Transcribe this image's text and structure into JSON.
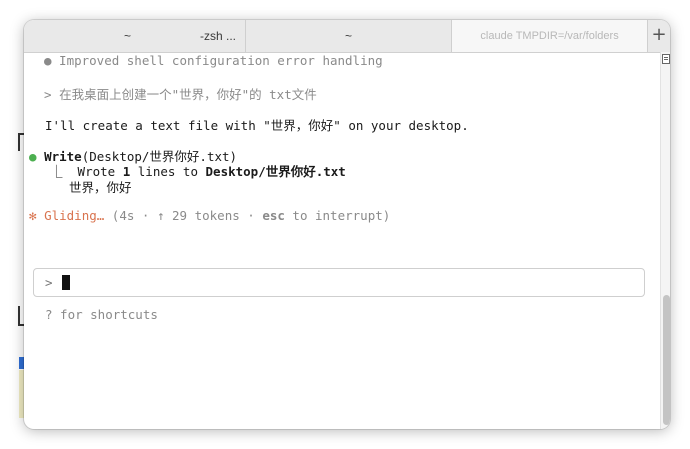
{
  "tabs": {
    "tab1_home": "~",
    "tab1_shell": "-zsh ...",
    "tab2_title": "~",
    "tab3_title": "claude TMPDIR=/var/folders",
    "add_label": "+"
  },
  "terminal": {
    "line_improved": "● Improved shell configuration error handling",
    "user_prompt_marker": ">",
    "user_prompt_text": "在我桌面上创建一个\"世界，你好\"的 txt文件",
    "assistant_reply": "I'll create a text file with \"世界，你好\" on your desktop.",
    "tool_dot": "●",
    "tool_name": "Write",
    "tool_args": "(Desktop/世界你好.txt)",
    "result_prefix": "⎿  Wrote ",
    "result_count": "1",
    "result_mid": " lines to ",
    "result_path": "Desktop/世界你好.txt",
    "result_content": "世界，你好",
    "status_star": "✻",
    "status_word": "Gliding…",
    "status_open": " (4s · ↑ 29 tokens · ",
    "status_key": "esc",
    "status_close": " to interrupt)",
    "input_prompt": ">",
    "input_value": "",
    "shortcuts_hint": "? for shortcuts"
  }
}
